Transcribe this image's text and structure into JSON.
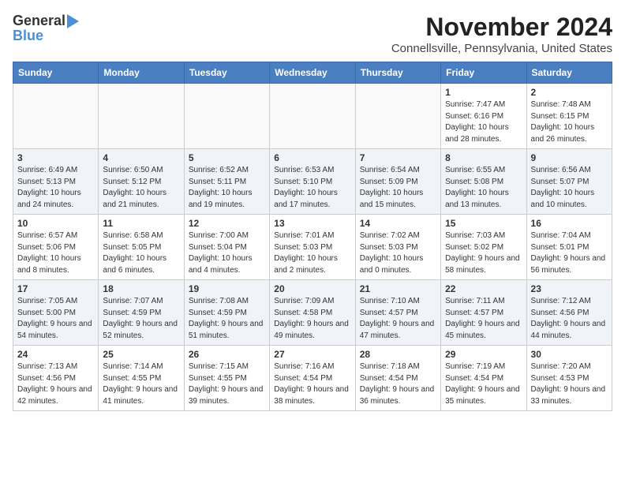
{
  "header": {
    "logo_general": "General",
    "logo_blue": "Blue",
    "title": "November 2024",
    "subtitle": "Connellsville, Pennsylvania, United States"
  },
  "weekdays": [
    "Sunday",
    "Monday",
    "Tuesday",
    "Wednesday",
    "Thursday",
    "Friday",
    "Saturday"
  ],
  "weeks": [
    [
      {
        "day": "",
        "info": ""
      },
      {
        "day": "",
        "info": ""
      },
      {
        "day": "",
        "info": ""
      },
      {
        "day": "",
        "info": ""
      },
      {
        "day": "",
        "info": ""
      },
      {
        "day": "1",
        "info": "Sunrise: 7:47 AM\nSunset: 6:16 PM\nDaylight: 10 hours and 28 minutes."
      },
      {
        "day": "2",
        "info": "Sunrise: 7:48 AM\nSunset: 6:15 PM\nDaylight: 10 hours and 26 minutes."
      }
    ],
    [
      {
        "day": "3",
        "info": "Sunrise: 6:49 AM\nSunset: 5:13 PM\nDaylight: 10 hours and 24 minutes."
      },
      {
        "day": "4",
        "info": "Sunrise: 6:50 AM\nSunset: 5:12 PM\nDaylight: 10 hours and 21 minutes."
      },
      {
        "day": "5",
        "info": "Sunrise: 6:52 AM\nSunset: 5:11 PM\nDaylight: 10 hours and 19 minutes."
      },
      {
        "day": "6",
        "info": "Sunrise: 6:53 AM\nSunset: 5:10 PM\nDaylight: 10 hours and 17 minutes."
      },
      {
        "day": "7",
        "info": "Sunrise: 6:54 AM\nSunset: 5:09 PM\nDaylight: 10 hours and 15 minutes."
      },
      {
        "day": "8",
        "info": "Sunrise: 6:55 AM\nSunset: 5:08 PM\nDaylight: 10 hours and 13 minutes."
      },
      {
        "day": "9",
        "info": "Sunrise: 6:56 AM\nSunset: 5:07 PM\nDaylight: 10 hours and 10 minutes."
      }
    ],
    [
      {
        "day": "10",
        "info": "Sunrise: 6:57 AM\nSunset: 5:06 PM\nDaylight: 10 hours and 8 minutes."
      },
      {
        "day": "11",
        "info": "Sunrise: 6:58 AM\nSunset: 5:05 PM\nDaylight: 10 hours and 6 minutes."
      },
      {
        "day": "12",
        "info": "Sunrise: 7:00 AM\nSunset: 5:04 PM\nDaylight: 10 hours and 4 minutes."
      },
      {
        "day": "13",
        "info": "Sunrise: 7:01 AM\nSunset: 5:03 PM\nDaylight: 10 hours and 2 minutes."
      },
      {
        "day": "14",
        "info": "Sunrise: 7:02 AM\nSunset: 5:03 PM\nDaylight: 10 hours and 0 minutes."
      },
      {
        "day": "15",
        "info": "Sunrise: 7:03 AM\nSunset: 5:02 PM\nDaylight: 9 hours and 58 minutes."
      },
      {
        "day": "16",
        "info": "Sunrise: 7:04 AM\nSunset: 5:01 PM\nDaylight: 9 hours and 56 minutes."
      }
    ],
    [
      {
        "day": "17",
        "info": "Sunrise: 7:05 AM\nSunset: 5:00 PM\nDaylight: 9 hours and 54 minutes."
      },
      {
        "day": "18",
        "info": "Sunrise: 7:07 AM\nSunset: 4:59 PM\nDaylight: 9 hours and 52 minutes."
      },
      {
        "day": "19",
        "info": "Sunrise: 7:08 AM\nSunset: 4:59 PM\nDaylight: 9 hours and 51 minutes."
      },
      {
        "day": "20",
        "info": "Sunrise: 7:09 AM\nSunset: 4:58 PM\nDaylight: 9 hours and 49 minutes."
      },
      {
        "day": "21",
        "info": "Sunrise: 7:10 AM\nSunset: 4:57 PM\nDaylight: 9 hours and 47 minutes."
      },
      {
        "day": "22",
        "info": "Sunrise: 7:11 AM\nSunset: 4:57 PM\nDaylight: 9 hours and 45 minutes."
      },
      {
        "day": "23",
        "info": "Sunrise: 7:12 AM\nSunset: 4:56 PM\nDaylight: 9 hours and 44 minutes."
      }
    ],
    [
      {
        "day": "24",
        "info": "Sunrise: 7:13 AM\nSunset: 4:56 PM\nDaylight: 9 hours and 42 minutes."
      },
      {
        "day": "25",
        "info": "Sunrise: 7:14 AM\nSunset: 4:55 PM\nDaylight: 9 hours and 41 minutes."
      },
      {
        "day": "26",
        "info": "Sunrise: 7:15 AM\nSunset: 4:55 PM\nDaylight: 9 hours and 39 minutes."
      },
      {
        "day": "27",
        "info": "Sunrise: 7:16 AM\nSunset: 4:54 PM\nDaylight: 9 hours and 38 minutes."
      },
      {
        "day": "28",
        "info": "Sunrise: 7:18 AM\nSunset: 4:54 PM\nDaylight: 9 hours and 36 minutes."
      },
      {
        "day": "29",
        "info": "Sunrise: 7:19 AM\nSunset: 4:54 PM\nDaylight: 9 hours and 35 minutes."
      },
      {
        "day": "30",
        "info": "Sunrise: 7:20 AM\nSunset: 4:53 PM\nDaylight: 9 hours and 33 minutes."
      }
    ]
  ]
}
